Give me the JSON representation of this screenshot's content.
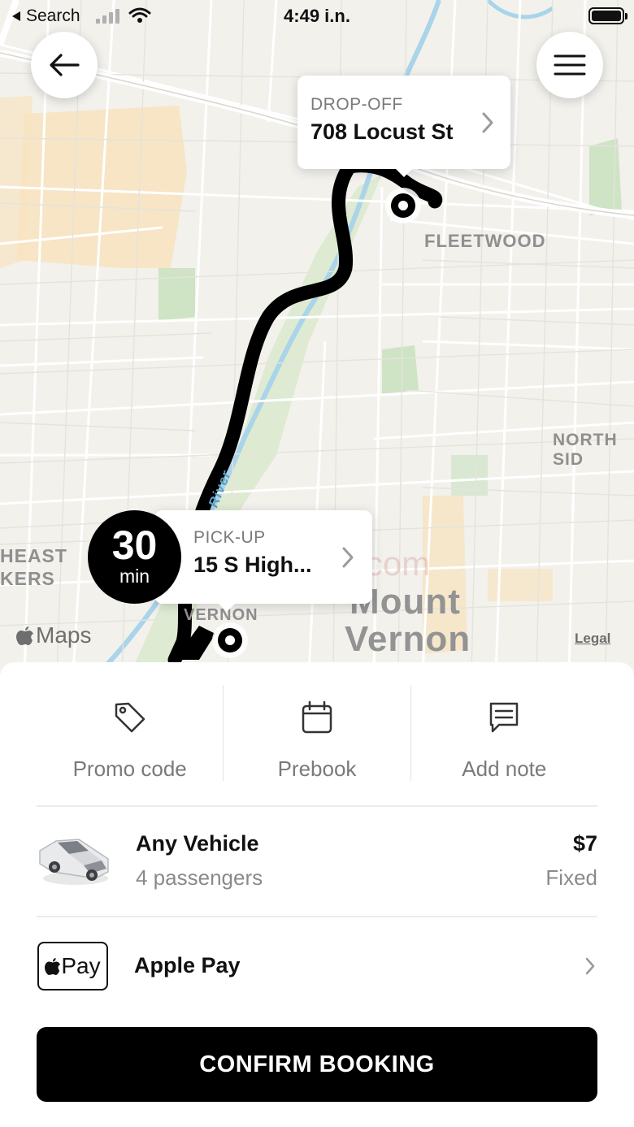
{
  "status_bar": {
    "back_label": "Search",
    "time": "4:49 i.n."
  },
  "map": {
    "dropoff": {
      "caption": "DROP-OFF",
      "address": "708 Locust St"
    },
    "pickup": {
      "caption": "PICK-UP",
      "address": "15 S High..."
    },
    "eta": {
      "value": "30",
      "unit": "min"
    },
    "labels": {
      "fleetwood": "FLEETWOOD",
      "north_side": "NORTH SID",
      "heast": "HEAST",
      "kers": "KERS",
      "vernon_small": "VERNON",
      "mount": "Mount",
      "vernon": "Vernon",
      "river": "r River"
    },
    "maps_logo": "Maps",
    "legal": "Legal",
    "watermark": "UpdateStar.com"
  },
  "actions": [
    {
      "label": "Promo code",
      "icon": "tag-icon"
    },
    {
      "label": "Prebook",
      "icon": "calendar-icon"
    },
    {
      "label": "Add note",
      "icon": "message-icon"
    }
  ],
  "vehicle": {
    "name": "Any Vehicle",
    "capacity": "4 passengers",
    "price": "$7",
    "price_type": "Fixed"
  },
  "payment": {
    "badge": "Pay",
    "method": "Apple Pay"
  },
  "confirm_label": "CONFIRM BOOKING"
}
